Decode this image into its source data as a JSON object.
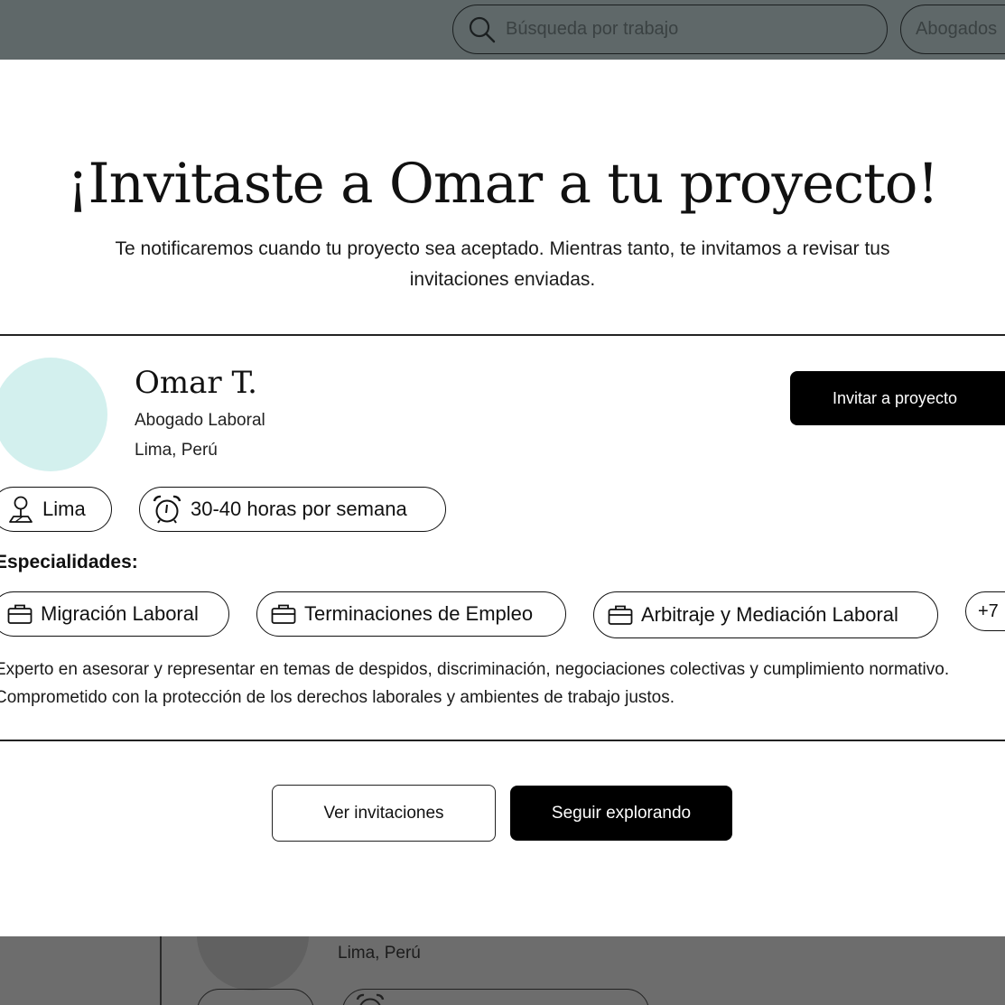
{
  "header": {
    "search_placeholder": "Búsqueda por trabajo",
    "category_label": "Abogados"
  },
  "modal": {
    "title": "¡Invitaste a Omar a tu proyecto!",
    "subtitle": "Te notificaremos cuando tu proyecto sea aceptado. Mientras tanto, te invitamos a revisar tus invitaciones enviadas.",
    "profile": {
      "name": "Omar T.",
      "role": "Abogado Laboral",
      "location": "Lima, Perú",
      "invite_button": "Invitar a proyecto",
      "city_tag": "Lima",
      "hours_tag": "30-40 horas por semana",
      "specialties_title": "Especialidades:",
      "specialties": [
        "Migración Laboral",
        "Terminaciones de Empleo",
        "Arbitraje y Mediación Laboral"
      ],
      "more_specialties": "+7",
      "bio": "Experto en asesorar y representar en temas de despidos, discriminación, negociaciones colectivas y cumplimiento normativo. Comprometido con la protección de los derechos laborales y ambientes de trabajo justos."
    },
    "actions": {
      "view_invitations": "Ver invitaciones",
      "keep_exploring": "Seguir explorando"
    }
  },
  "background": {
    "location": "Lima, Perú"
  },
  "colors": {
    "avatar_bg": "#d3f0ee",
    "overlay_header": "#5f6869",
    "primary_button": "#000000"
  }
}
